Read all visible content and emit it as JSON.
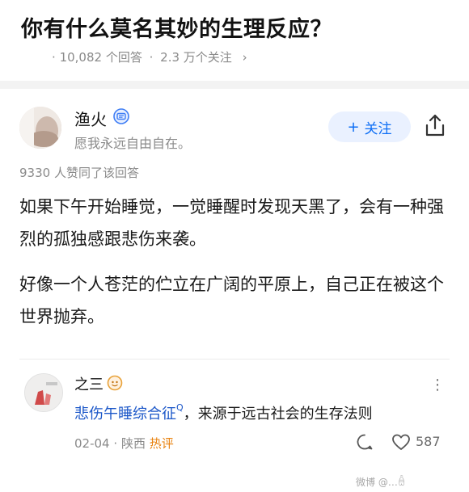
{
  "question": {
    "title": "你有什么莫名其妙的生理反应？",
    "answer_count": "10,082 个回答",
    "follower_count": "2.3 万个关注",
    "chevron": "›"
  },
  "answer": {
    "author_name": "渔火",
    "author_bio": "愿我永远自由自在。",
    "follow_label": "关注",
    "follow_plus": "+",
    "upvote_summary": "9330 人赞同了该回答",
    "paragraphs": [
      "如果下午开始睡觉，一觉睡醒时发现天黑了，会有一种强烈的孤独感跟悲伤来袭。",
      "好像一个人苍茫的伫立在广阔的平原上，自己正在被这个世界抛弃。"
    ]
  },
  "comment": {
    "author_name": "之三",
    "more": "⋮",
    "link_text": "悲伤午睡综合征",
    "search_mark": "Q",
    "rest_text": "，来源于远古社会的生存法则",
    "date": "02-04",
    "location": "陕西",
    "hot_label": "热评",
    "like_count": "587"
  },
  "watermark": "微博 @…ꎁ"
}
